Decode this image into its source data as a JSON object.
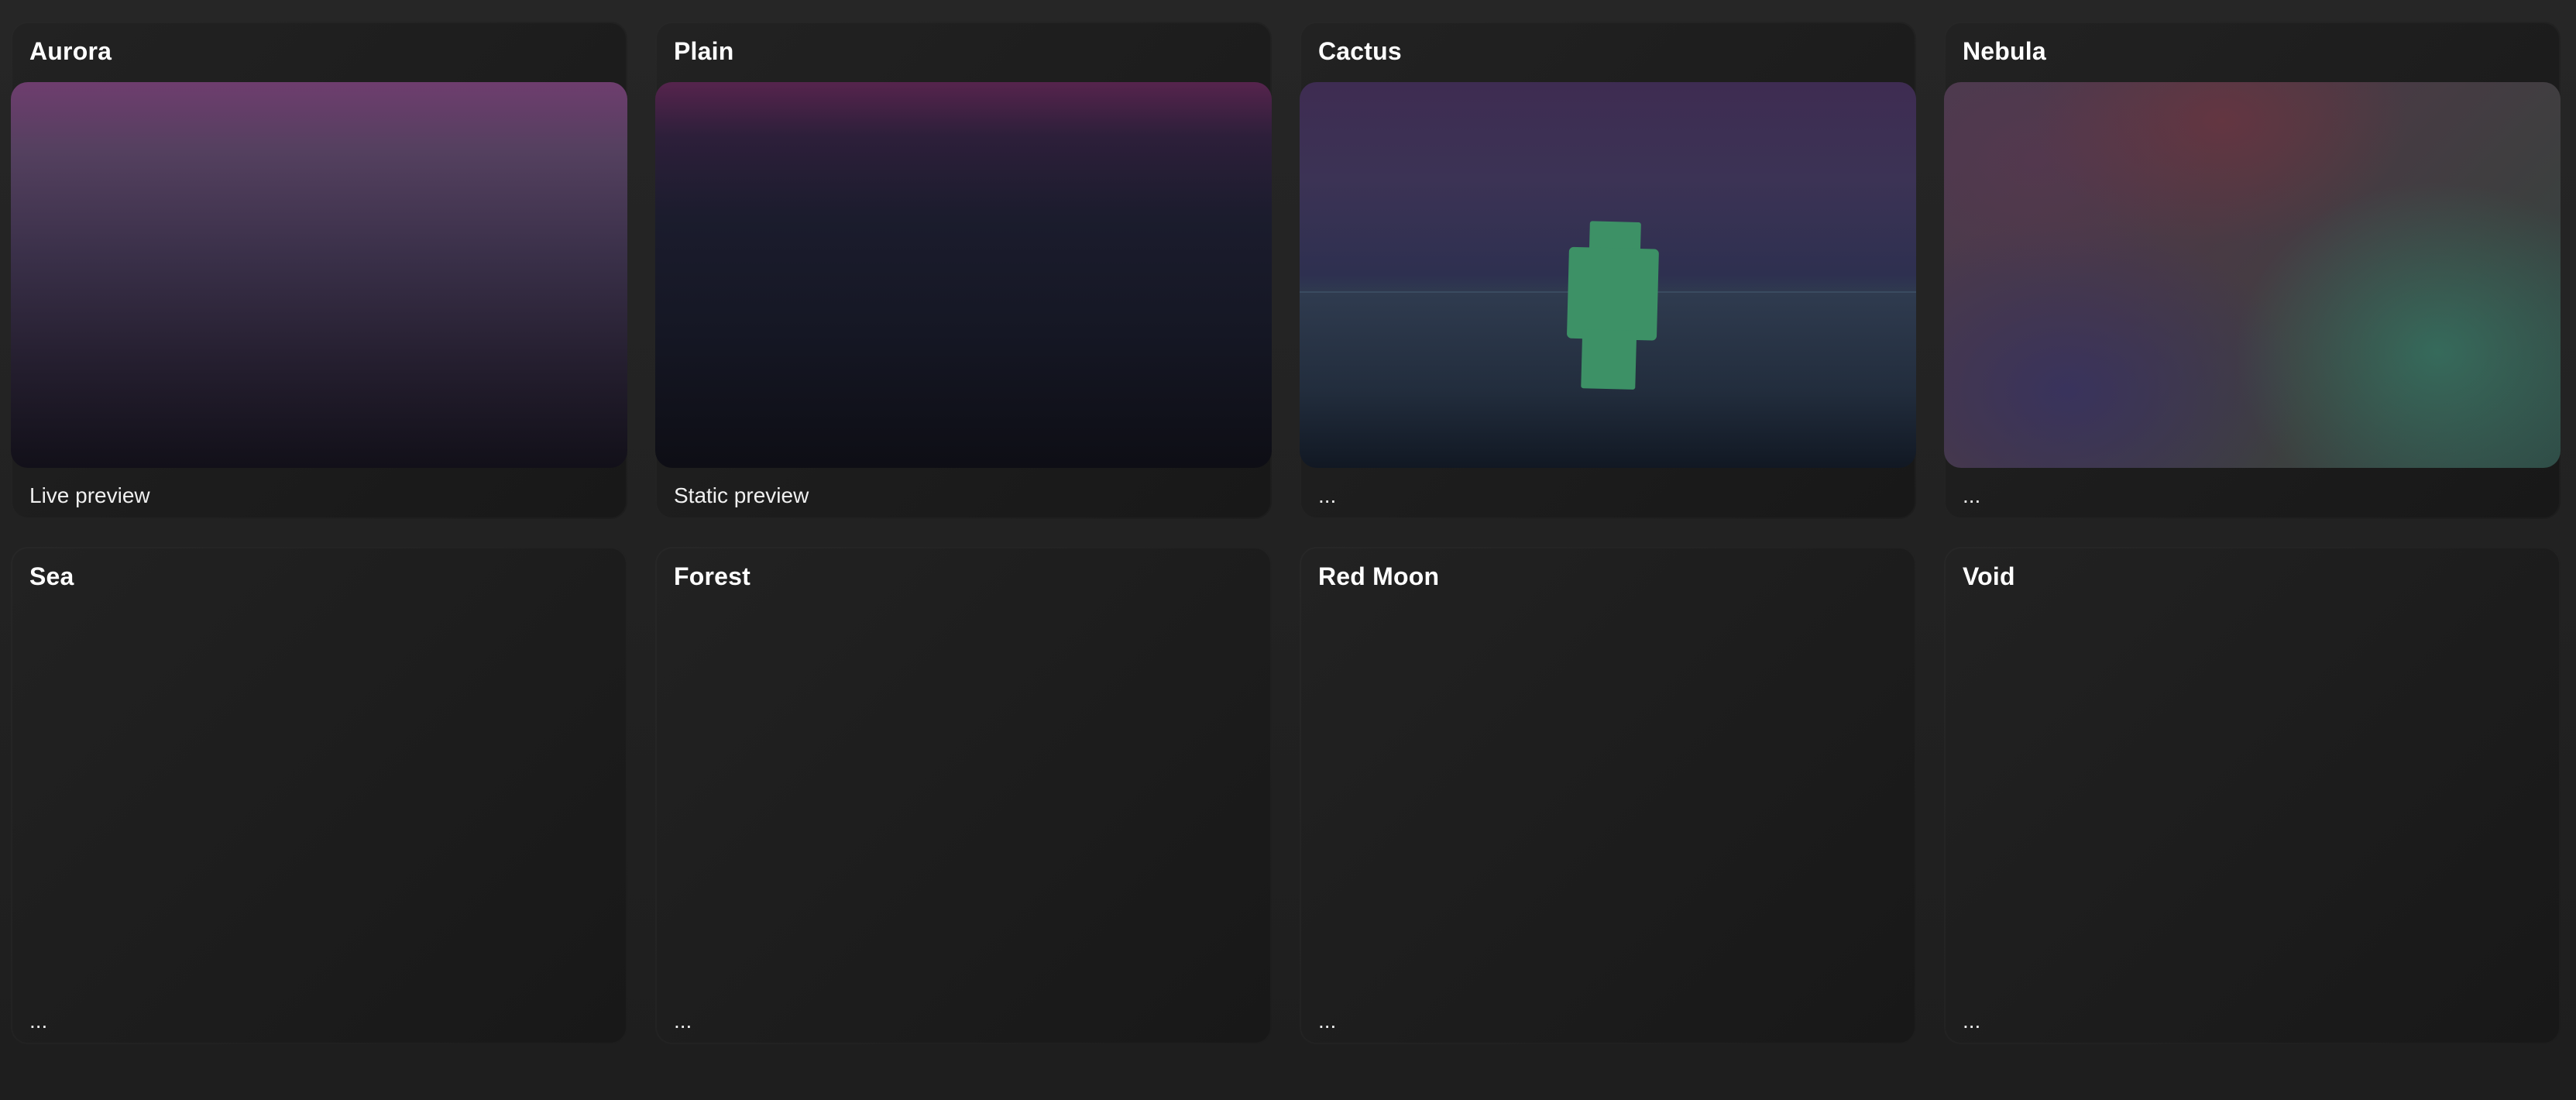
{
  "cards": [
    {
      "title": "Aurora",
      "caption": "Live preview",
      "preview": "aurora"
    },
    {
      "title": "Plain",
      "caption": "Static preview",
      "preview": "plain"
    },
    {
      "title": "Cactus",
      "caption": "...",
      "preview": "cactus"
    },
    {
      "title": "Nebula",
      "caption": "...",
      "preview": "nebula"
    },
    {
      "title": "Sea",
      "caption": "...",
      "preview": null
    },
    {
      "title": "Forest",
      "caption": "...",
      "preview": null
    },
    {
      "title": "Red Moon",
      "caption": "...",
      "preview": null
    },
    {
      "title": "Void",
      "caption": "...",
      "preview": null
    }
  ],
  "colors": {
    "background": "#232323",
    "card": "#1d1d1d",
    "text": "#ffffff",
    "cactus_green": "#3d9166"
  }
}
